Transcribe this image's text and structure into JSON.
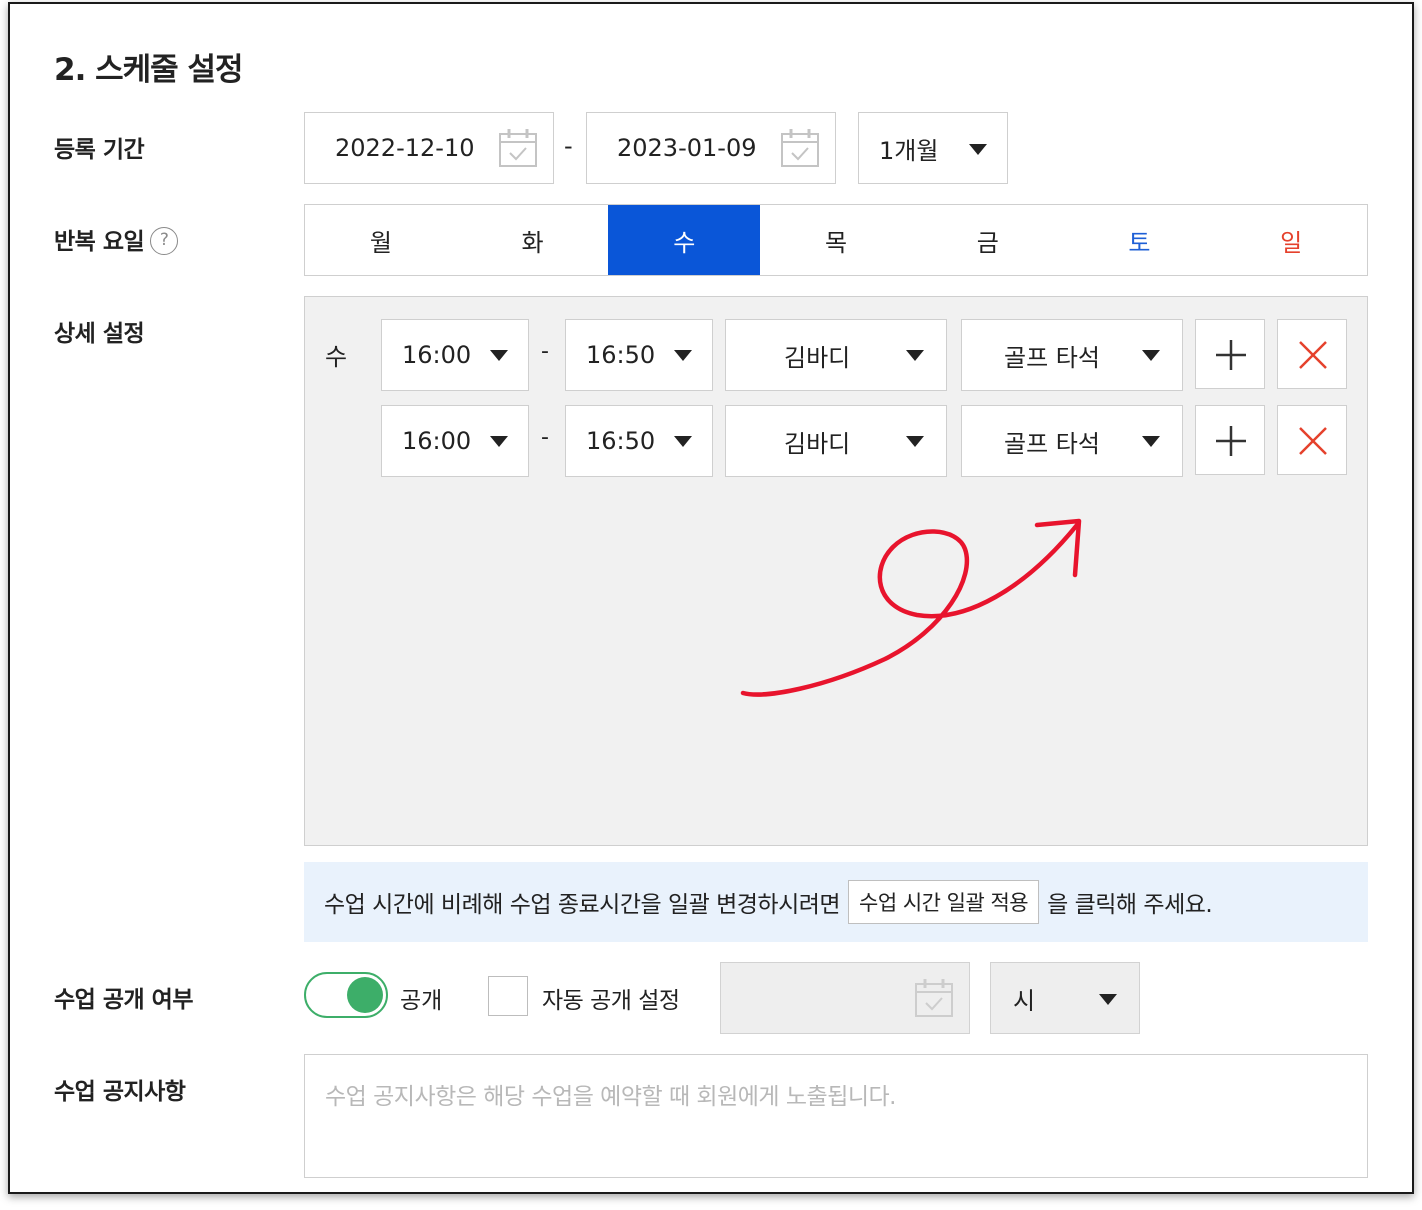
{
  "section": {
    "title": "2. 스케줄 설정"
  },
  "period": {
    "label": "등록 기간",
    "start_date": "2022-12-10",
    "end_date": "2023-01-09",
    "separator": "-",
    "duration": "1개월"
  },
  "repeat": {
    "label": "반복 요일",
    "help": "?",
    "days": [
      {
        "label": "월",
        "active": false
      },
      {
        "label": "화",
        "active": false
      },
      {
        "label": "수",
        "active": true
      },
      {
        "label": "목",
        "active": false
      },
      {
        "label": "금",
        "active": false
      },
      {
        "label": "토",
        "active": false
      },
      {
        "label": "일",
        "active": false
      }
    ]
  },
  "detail": {
    "label": "상세 설정",
    "day": "수",
    "rows": [
      {
        "start": "16:00",
        "end": "16:50",
        "instructor": "김바디",
        "place": "골프 타석"
      },
      {
        "start": "16:00",
        "end": "16:50",
        "instructor": "김바디",
        "place": "골프 타석"
      }
    ],
    "separator": "-"
  },
  "notice": {
    "before": "수업 시간에 비례해 수업 종료시간을 일괄 변경하시려면",
    "button": "수업 시간 일괄 적용",
    "after": "을 클릭해 주세요."
  },
  "visibility": {
    "label": "수업 공개 여부",
    "toggle_label": "공개",
    "toggle_on": true,
    "auto_label": "자동 공개 설정",
    "auto_checked": false,
    "hour_select": "시"
  },
  "announcement": {
    "label": "수업 공지사항",
    "placeholder": "수업 공지사항은 해당 수업을 예약할 때 회원에게 노출됩니다."
  },
  "colors": {
    "active_day": "#0a56d8",
    "saturday": "#1e5fd6",
    "sunday": "#e5412c",
    "toggle": "#3dae69",
    "delete": "#e5412c",
    "annotation": "#e8142d",
    "notice_bg": "#e9f2fc"
  }
}
